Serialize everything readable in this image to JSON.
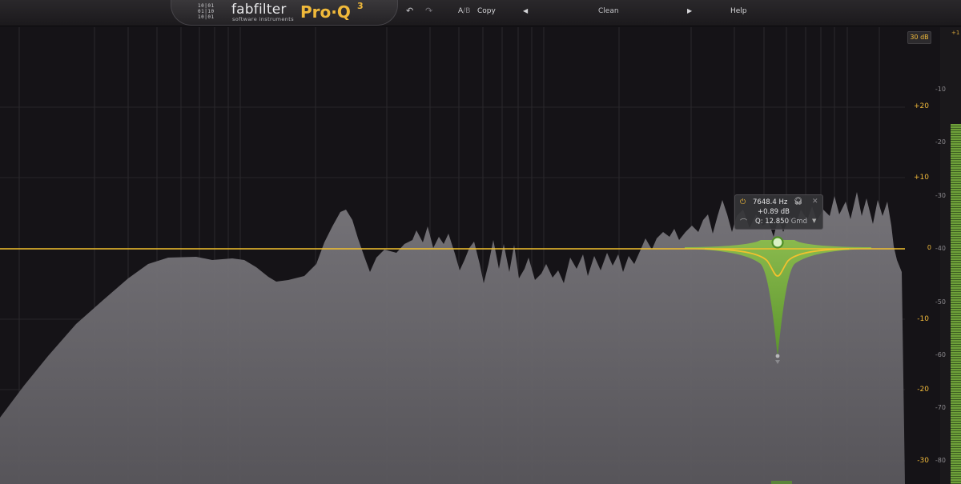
{
  "app": {
    "brand": "fabfilter",
    "brand_sub": "software instruments",
    "product": "Pro·Q",
    "product_version": "3",
    "logo_dots": "10|01\n01|10\n10|01"
  },
  "toolbar": {
    "undo_icon": "undo-icon",
    "redo_icon": "redo-icon",
    "ab_a": "A",
    "ab_sep": "/",
    "ab_b": "B",
    "copy_label": "Copy",
    "preset_prev_icon": "triangle-left-icon",
    "preset_name": "Clean",
    "preset_next_icon": "triangle-right-icon",
    "help_label": "Help"
  },
  "display": {
    "range_label": "30 dB",
    "eq_scale": [
      "+20",
      "+10",
      "0",
      "-10",
      "-20",
      "-30"
    ],
    "analyzer_scale": [
      "-10",
      "-20",
      "-30",
      "-40",
      "-50",
      "-60",
      "-70",
      "-80"
    ],
    "meter_top_label": "+1"
  },
  "band": {
    "frequency": "7648.4 Hz",
    "gain": "+0.89 dB",
    "q": "Q: 12.850",
    "shape": "Gmd",
    "power_icon": "power-icon",
    "headphones_icon": "headphones-icon",
    "close_icon": "close-icon",
    "shape_icon": "bell-shape-icon",
    "dropdown_icon": "chevron-down-icon"
  },
  "colors": {
    "eq_curve": "#f3c12e",
    "band_fill": "#6fae35",
    "spectrum": "#6d6b70",
    "accent": "#f0b93a"
  }
}
